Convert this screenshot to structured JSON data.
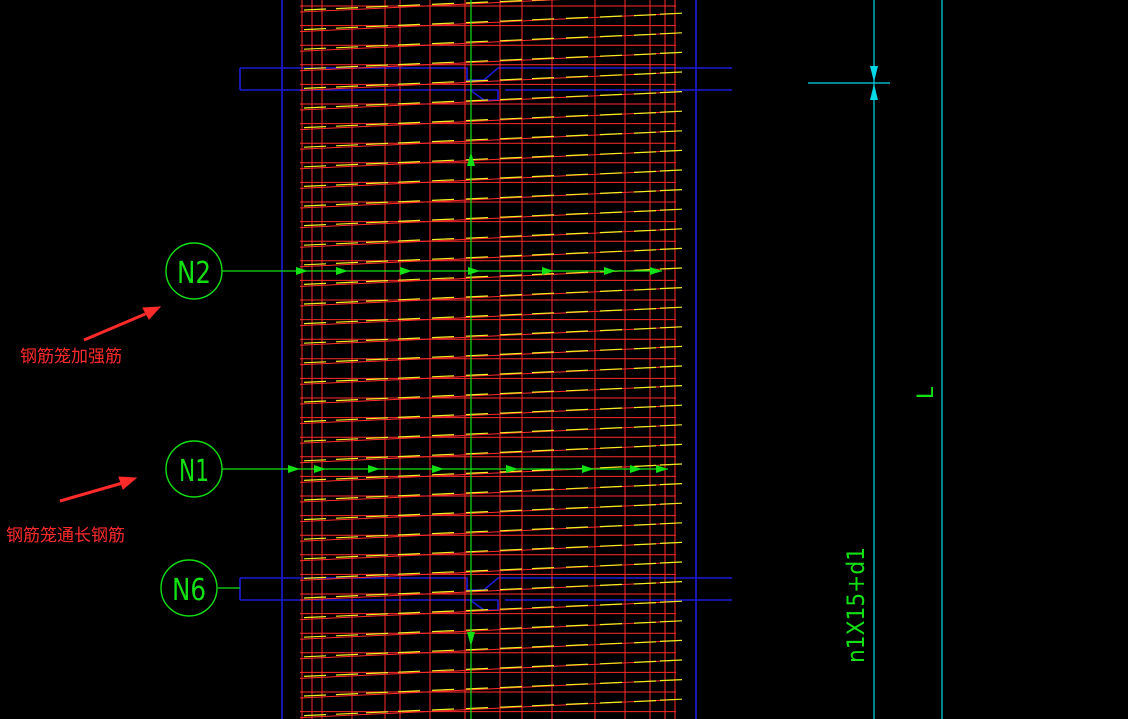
{
  "callouts": [
    {
      "id": "N2",
      "label": "N2"
    },
    {
      "id": "N1",
      "label": "N1"
    },
    {
      "id": "N6",
      "label": "N6"
    }
  ],
  "annotations": {
    "reinforcement_hoop": "钢筋笼加强筋",
    "longitudinal_bar": "钢筋笼通长钢筋"
  },
  "dimensions": {
    "length": "L",
    "spacing_formula": "n1X15+d1"
  },
  "colors": {
    "background": "#000000",
    "outline": "#1b1bd6",
    "rebar_red": "#ff2a2a",
    "tick_yellow": "#f0f020",
    "callout_green": "#12e012",
    "dim_cyan": "#00d8e8",
    "arrow_red": "#ff2a2a"
  }
}
